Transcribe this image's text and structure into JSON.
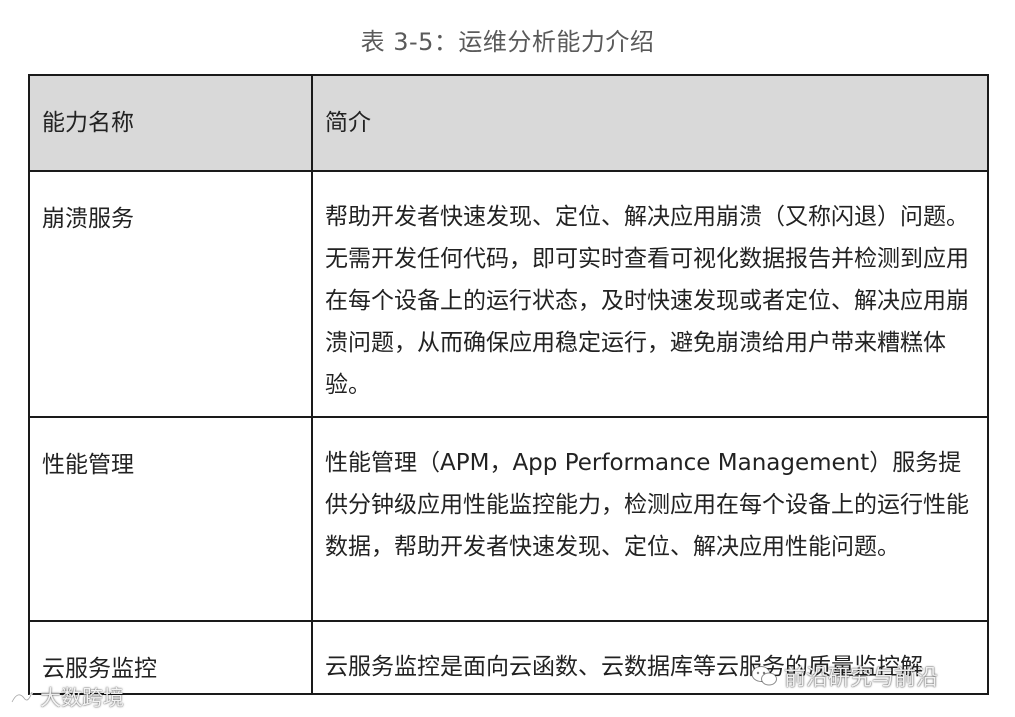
{
  "caption": "表 3-5：运维分析能力介绍",
  "table": {
    "headers": [
      "能力名称",
      "简介"
    ],
    "rows": [
      {
        "name": "崩溃服务",
        "description": "帮助开发者快速发现、定位、解决应用崩溃（又称闪退）问题。无需开发任何代码，即可实时查看可视化数据报告并检测到应用在每个设备上的运行状态，及时快速发现或者定位、解决应用崩溃问题，从而确保应用稳定运行，避免崩溃给用户带来糟糕体验。"
      },
      {
        "name": "性能管理",
        "description": "性能管理（APM，App Performance Management）服务提供分钟级应用性能监控能力，检测应用在每个设备上的运行性能数据，帮助开发者快速发现、定位、解决应用性能问题。"
      },
      {
        "name": "云服务监控",
        "description": "云服务监控是面向云函数、云数据库等云服务的质量监控解"
      }
    ]
  },
  "watermarks": {
    "left": "大数跨境",
    "right": "前沿研究与前沿"
  }
}
